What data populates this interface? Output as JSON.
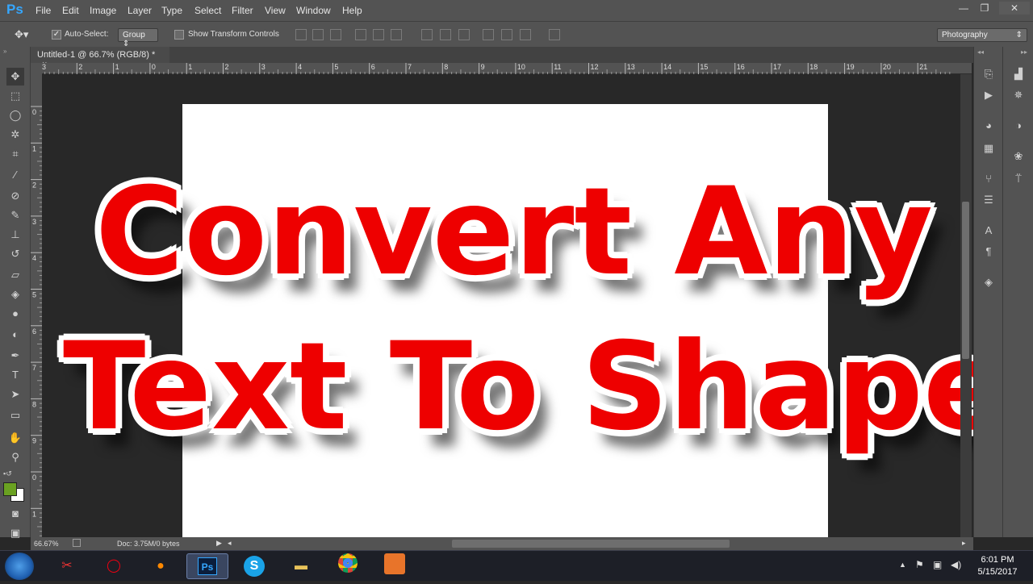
{
  "app": {
    "logo": "Ps"
  },
  "menu": [
    "File",
    "Edit",
    "Image",
    "Layer",
    "Type",
    "Select",
    "Filter",
    "View",
    "Window",
    "Help"
  ],
  "window_controls": {
    "minimize": "—",
    "restore": "❐",
    "close": "✕"
  },
  "options": {
    "auto_select_label": "Auto-Select:",
    "auto_select_value": "Group",
    "show_transform_label": "Show Transform Controls",
    "workspace": "Photography"
  },
  "document": {
    "tab_title": "Untitled-1 @ 66.7% (RGB/8) *",
    "tab_close": "×",
    "line1": "Convert Any",
    "line2": "Text To Shape",
    "text_color": "#ee0000"
  },
  "rulers": {
    "h_ticks": [
      "3",
      "2",
      "1",
      "0",
      "1",
      "2",
      "3",
      "4",
      "5",
      "6",
      "7",
      "8",
      "9",
      "10",
      "11",
      "12",
      "13",
      "14",
      "15",
      "16",
      "17",
      "18",
      "19",
      "20",
      "21"
    ],
    "v_ticks": [
      "0",
      "1",
      "2",
      "3",
      "4",
      "5",
      "6",
      "7",
      "8",
      "9",
      "0",
      "1"
    ]
  },
  "status": {
    "zoom": "66.67%",
    "doc": "Doc: 3.75M/0 bytes"
  },
  "colors": {
    "foreground": "#6aa121",
    "background": "#ffffff",
    "accent": "#35a7ff"
  },
  "taskbar": {
    "apps": [
      "start",
      "snipping-tool",
      "opera",
      "firefox",
      "photoshop",
      "skype",
      "file-explorer",
      "chrome",
      "orange-app"
    ],
    "ps_label": "Ps",
    "skype_label": "S",
    "clock_time": "6:01 PM",
    "clock_date": "5/15/2017"
  }
}
